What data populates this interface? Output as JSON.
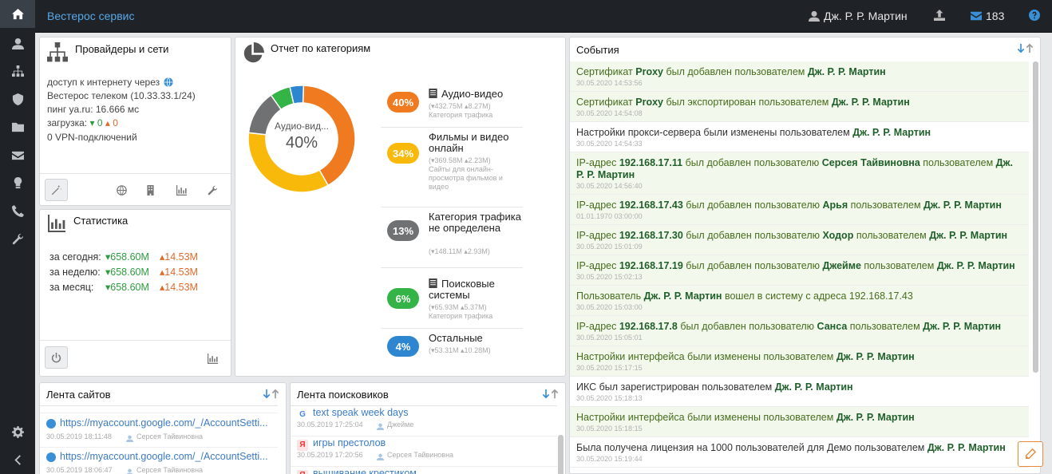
{
  "header": {
    "brand": "Вестерос сервис",
    "user": "Дж. Р. Р. Мартин",
    "mail_count": "183"
  },
  "providers": {
    "title": "Провайдеры и сети",
    "access_label": "доступ к интернету через",
    "provider_line": "Вестерос телеком (10.33.33.1/24)",
    "ping": "пинг ya.ru: 16.666 мс",
    "load_label": "загрузка:",
    "load_down": "0",
    "load_up": "0",
    "vpn": "0 VPN-подключений"
  },
  "stats": {
    "title": "Статистика",
    "rows": [
      {
        "label": "за сегодня:",
        "down": "658.60M",
        "up": "14.53M"
      },
      {
        "label": "за неделю:",
        "down": "658.60M",
        "up": "14.53M"
      },
      {
        "label": "за месяц:",
        "down": "658.60M",
        "up": "14.53M"
      }
    ]
  },
  "categories": {
    "title": "Отчет по категориям",
    "donut_label": "Аудио-вид...",
    "donut_pct": "40%",
    "items": [
      {
        "pct": "40%",
        "name": "Аудио-видео",
        "traffic": "(▾432.75M ▴8.27M)",
        "desc": "Категория трафика",
        "color": "#f07a1f"
      },
      {
        "pct": "34%",
        "name": "Фильмы и видео онлайн",
        "traffic": "(▾369.58M ▴2.23M)",
        "desc": "Сайты для онлайн-просмотра фильмов и видео",
        "color": "#f9b90b"
      },
      {
        "pct": "13%",
        "name": "Категория трафика не определена",
        "traffic": "(▾148.11M ▴2.93M)",
        "desc": "",
        "color": "#6f7173"
      },
      {
        "pct": "6%",
        "name": "Поисковые системы",
        "traffic": "(▾65.93M ▴5.37M)",
        "desc": "Категория трафика",
        "color": "#34b347"
      },
      {
        "pct": "4%",
        "name": "Остальные",
        "traffic": "(▾53.31M ▴10.28M)",
        "desc": "",
        "color": "#2d86cf"
      }
    ]
  },
  "events": {
    "title": "События",
    "items": [
      {
        "text": "Сертификат <b>Proxy</b> был добавлен пользователем <b>Дж. Р. Р. Мартин</b>",
        "date": "30.05.2020 14:53:56",
        "hl": true
      },
      {
        "text": "Сертификат <b>Proxy</b> был экспортирован пользователем <b>Дж. Р. Р. Мартин</b>",
        "date": "30.05.2020 14:54:08",
        "hl": true
      },
      {
        "text": "Настройки прокси-сервера были изменены пользователем <b>Дж. Р. Р. Мартин</b>",
        "date": "30.05.2020 14:54:33",
        "hl": false
      },
      {
        "text": "IP-адрес <b>192.168.17.11</b> был добавлен пользователю <b>Серсея Тайвиновна</b> пользователем <b>Дж. Р. Р. Мартин</b>",
        "date": "30.05.2020 14:56:40",
        "hl": true
      },
      {
        "text": "IP-адрес <b>192.168.17.43</b> был добавлен пользователю <b>Арья</b> пользователем <b>Дж. Р. Р. Мартин</b>",
        "date": "01.01.1970 03:00:00",
        "hl": true
      },
      {
        "text": "IP-адрес <b>192.168.17.30</b> был добавлен пользователю <b>Ходор</b> пользователем <b>Дж. Р. Р. Мартин</b>",
        "date": "30.05.2020 15:01:09",
        "hl": true
      },
      {
        "text": "IP-адрес <b>192.168.17.19</b> был добавлен пользователю <b>Джейме</b> пользователем <b>Дж. Р. Р. Мартин</b>",
        "date": "30.05.2020 15:02:13",
        "hl": true
      },
      {
        "text": "Пользователь <b>Дж. Р. Р. Мартин</b> вошел в систему с адреса 192.168.17.43",
        "date": "30.05.2020 15:03:00",
        "hl": true
      },
      {
        "text": "IP-адрес <b>192.168.17.8</b> был добавлен пользователю <b>Санса</b> пользователем <b>Дж. Р. Р. Мартин</b>",
        "date": "30.05.2020 15:05:01",
        "hl": true
      },
      {
        "text": "Настройки интерфейса были изменены пользователем <b>Дж. Р. Р. Мартин</b>",
        "date": "30.05.2020 15:17:15",
        "hl": true
      },
      {
        "text": "ИКС был зарегистрирован пользователем <b>Дж. Р. Р. Мартин</b>",
        "date": "30.05.2020 15:18:13",
        "hl": false
      },
      {
        "text": "Настройки интерфейса были изменены пользователем <b>Дж. Р. Р. Мартин</b>",
        "date": "30.05.2020 15:18:15",
        "hl": true
      },
      {
        "text": "Была получена лицензия на 1000 пользователей для Демо пользователем <b>Дж. Р. Р. Мартин</b>",
        "date": "30.05.2020 15:19:44",
        "hl": false
      }
    ]
  },
  "sites": {
    "title": "Лента сайтов",
    "items": [
      {
        "url": "https://myaccount.google.com/_/AccountSetti...",
        "date": "30.05.2019 18:11:48",
        "user": "Серсея Тайвиновна"
      },
      {
        "url": "https://myaccount.google.com/_/AccountSetti...",
        "date": "30.05.2019 18:06:47",
        "user": "Серсея Тайвиновна"
      }
    ]
  },
  "search": {
    "title": "Лента поисковиков",
    "items": [
      {
        "query": "text speak week days",
        "date": "30.05.2019 17:25:04",
        "user": "Джейме",
        "engine": "G"
      },
      {
        "query": "игры престолов",
        "date": "30.05.2019 17:20:56",
        "user": "Серсея Тайвиновна",
        "engine": "Я"
      },
      {
        "query": "вышивание крестиком",
        "date": "",
        "user": "",
        "engine": "Я"
      }
    ]
  }
}
